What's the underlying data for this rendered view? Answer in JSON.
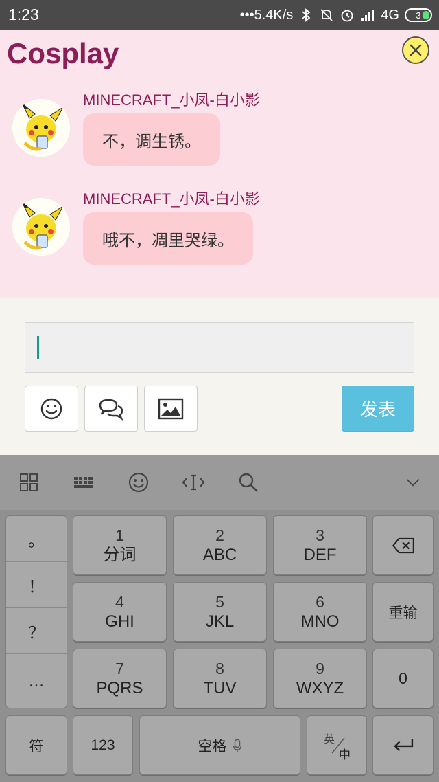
{
  "status_bar": {
    "time": "1:23",
    "network_speed": "•••5.4K/s",
    "signal_label": "4G",
    "battery_level": "3"
  },
  "app": {
    "title": "Cosplay"
  },
  "messages": [
    {
      "sender": "MINECRAFT_小凤-白小影",
      "text": "不，调生锈。"
    },
    {
      "sender": "MINECRAFT_小凤-白小影",
      "text": "哦不，凋里哭绿。"
    }
  ],
  "composer": {
    "input_value": "",
    "send_label": "发表"
  },
  "keyboard": {
    "punctuation": [
      "。",
      "！",
      "？",
      "…"
    ],
    "keys": [
      {
        "num": "1",
        "label": "分词"
      },
      {
        "num": "2",
        "label": "ABC"
      },
      {
        "num": "3",
        "label": "DEF"
      },
      {
        "num": "4",
        "label": "GHI"
      },
      {
        "num": "5",
        "label": "JKL"
      },
      {
        "num": "6",
        "label": "MNO"
      },
      {
        "num": "7",
        "label": "PQRS"
      },
      {
        "num": "8",
        "label": "TUV"
      },
      {
        "num": "9",
        "label": "WXYZ"
      }
    ],
    "reenter": "重输",
    "zero": "0",
    "symbols": "符",
    "numbers": "123",
    "space": "空格",
    "lang_top": "英",
    "lang_bottom": "中"
  }
}
